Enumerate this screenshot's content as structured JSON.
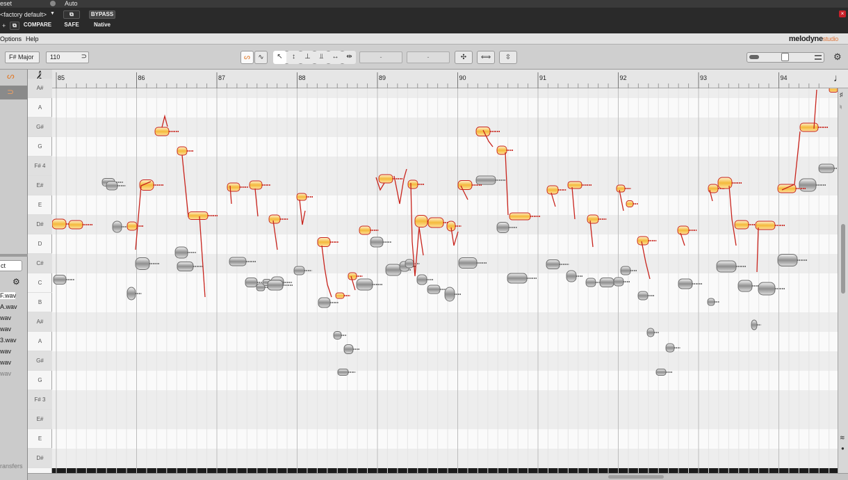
{
  "host": {
    "preset_label": "eset",
    "automation_label": "Auto",
    "preset_value": "<factory default>",
    "compare_label": "COMPARE",
    "bypass_label": "BYPASS",
    "safe_label": "SAFE",
    "native_label": "Native",
    "plus_label": "+",
    "close_label": "×"
  },
  "menu": {
    "items": [
      "Options",
      "Help"
    ],
    "brand": "melodyne",
    "brand_edition": "studio"
  },
  "toolbar": {
    "scale": "F# Major",
    "tempo": "110",
    "field_a": "-",
    "field_b": "-"
  },
  "ruler": {
    "bars": [
      "85",
      "86",
      "87",
      "88",
      "89",
      "90",
      "91",
      "92",
      "93",
      "94"
    ]
  },
  "piano": {
    "notes": [
      "A#",
      "A",
      "G#",
      "G",
      "F# 4",
      "E#",
      "E",
      "D#",
      "D",
      "C#",
      "C",
      "B",
      "A#",
      "A",
      "G#",
      "G",
      "F# 3",
      "E#",
      "E",
      "D#"
    ]
  },
  "left_panel": {
    "search_text": "ct",
    "files": [
      "F.wav",
      "A.wav",
      "wav",
      "wav",
      "3.wav",
      "wav",
      "wav",
      "wav"
    ],
    "transfers_label": "ransfers"
  },
  "colors": {
    "blob_orange": "#f4b93c",
    "blob_red": "#c8231c",
    "blob_grey": "#9a9a9a",
    "close_red": "#c8202a"
  }
}
